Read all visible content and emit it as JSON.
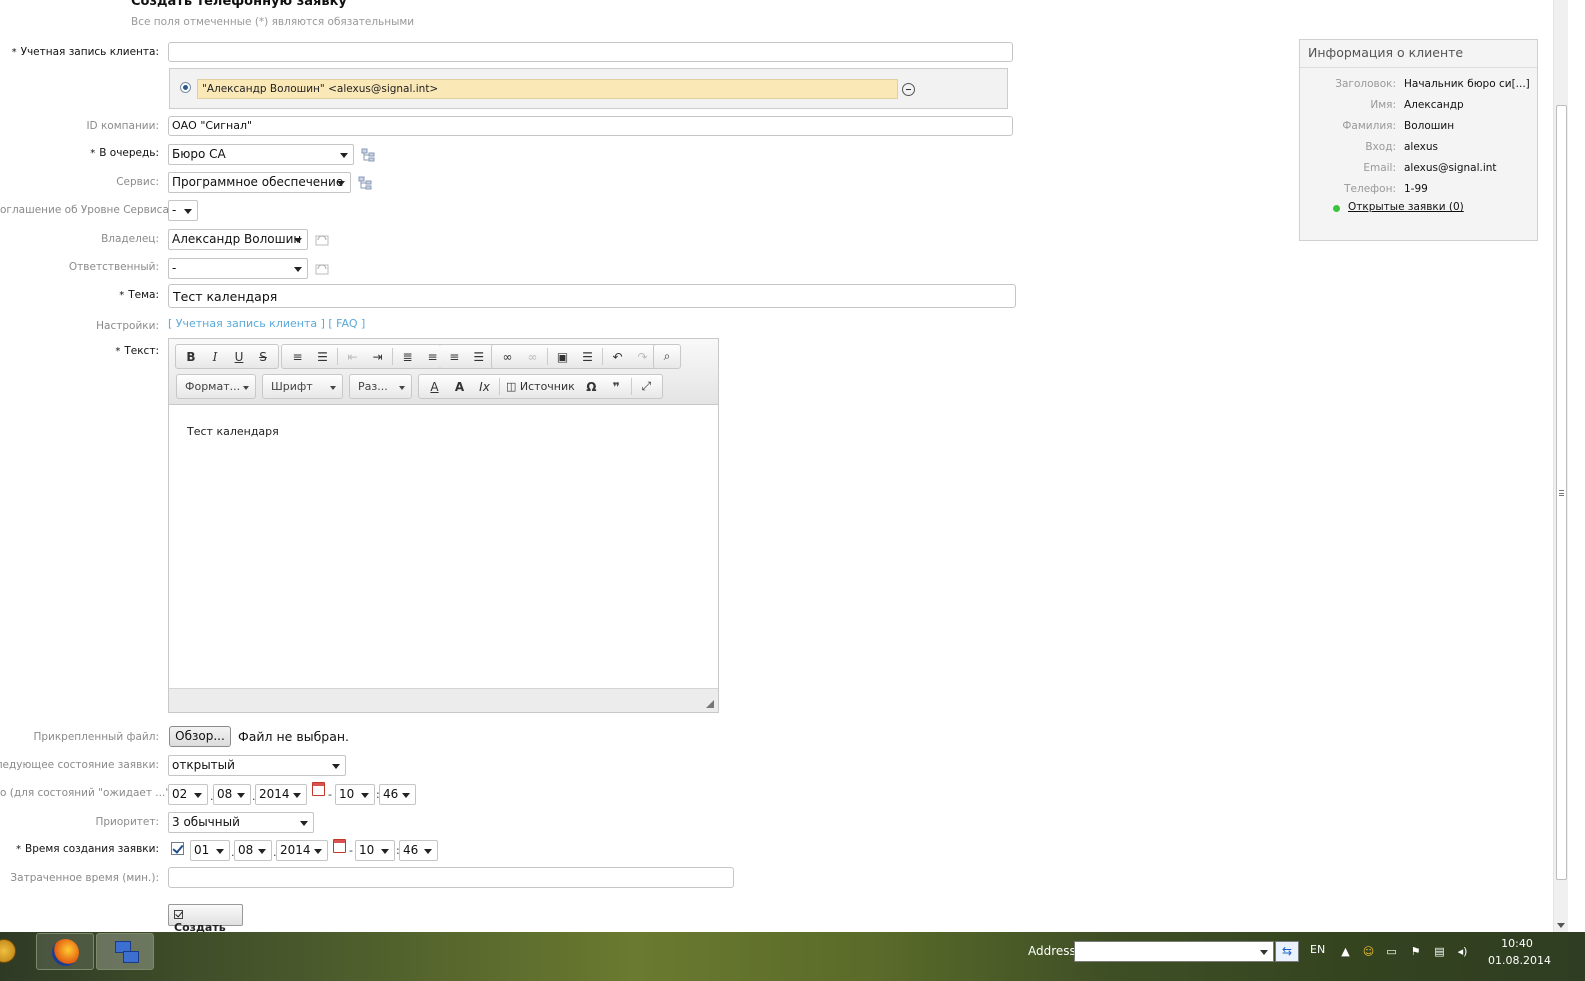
{
  "page": {
    "title": "Создать телефонную заявку",
    "subtitle": "Все поля отмеченные (*) являются обязательными"
  },
  "form": {
    "customer_user_label": "Учетная запись клиента:",
    "customer_user_value": "",
    "selected_customer": "\"Александр Волошин\" <alexus@signal.int>",
    "company_label": "ID компании:",
    "company_value": "ОАО \"Сигнал\"",
    "queue_label": "В очередь:",
    "queue_value": "Бюро СА",
    "service_label": "Сервис:",
    "service_value": "Программное обеспечение",
    "sla_label": "оглашение об Уровне Сервиса:",
    "sla_value": "-",
    "owner_label": "Владелец:",
    "owner_value": "Александр Волошин",
    "responsible_label": "Ответственный:",
    "responsible_value": "-",
    "subject_label": "Тема:",
    "subject_value": "Тест календаря",
    "options_label": "Настройки:",
    "options_links": "[ Учетная запись клиента ] [ FAQ ]",
    "text_label": "Текст:",
    "text_value": "Тест календаря",
    "attachment_label": "Прикрепленный файл:",
    "browse_label": "Обзор...",
    "no_file_label": "Файл не выбран.",
    "next_state_label": "Следующее состояние заявки:",
    "next_state_value": "открытый",
    "pending_label": "о (для состояний \"ожидает ...\"):",
    "pending_date": {
      "day": "02",
      "month": "08",
      "year": "2014",
      "hour": "10",
      "minute": "46"
    },
    "priority_label": "Приоритет:",
    "priority_value": "3 обычный",
    "created_label": "Время создания заявки:",
    "created_date": {
      "day": "01",
      "month": "08",
      "year": "2014",
      "hour": "10",
      "minute": "46"
    },
    "time_units_label": "Затраченное время (мин.):",
    "time_units_value": "",
    "submit_label": "Создать"
  },
  "editor": {
    "format_label": "Формат...",
    "font_label": "Шрифт",
    "size_label": "Раз...",
    "source_label": "Источник",
    "icons": [
      "bold-icon",
      "italic-icon",
      "underline-icon",
      "strikethrough-icon",
      "numbered-list-icon",
      "bullet-list-icon",
      "outdent-icon",
      "indent-icon",
      "align-left-icon",
      "align-center-icon",
      "align-right-icon",
      "justify-icon",
      "link-icon",
      "unlink-icon",
      "image-icon",
      "horizontal-rule-icon",
      "undo-icon",
      "redo-icon",
      "find-icon"
    ]
  },
  "customer_info": {
    "title": "Информация о клиенте",
    "rows": [
      {
        "key": "Заголовок:",
        "value": "Начальник бюро си[...]"
      },
      {
        "key": "Имя:",
        "value": "Александр"
      },
      {
        "key": "Фамилия:",
        "value": "Волошин"
      },
      {
        "key": "Вход:",
        "value": "alexus"
      },
      {
        "key": "Email:",
        "value": "alexus@signal.int"
      },
      {
        "key": "Телефон:",
        "value": "1-99"
      }
    ],
    "open_tickets": "Открытые заявки (0)"
  },
  "taskbar": {
    "address_label": "Address",
    "lang": "EN",
    "time": "10:40",
    "date": "01.08.2014"
  },
  "colors": {
    "required_star": "#111111",
    "link": "#5aa9d8",
    "chip_bg": "#fbe8b7",
    "open_dot": "#3cc43c"
  }
}
